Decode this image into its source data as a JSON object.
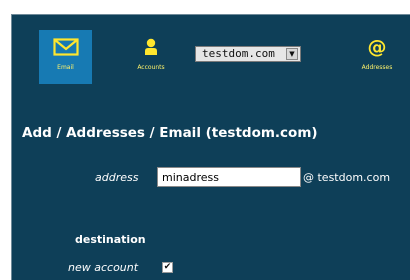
{
  "nav": {
    "items": [
      {
        "label": "Email",
        "icon": "envelope-icon",
        "active": true
      },
      {
        "label": "Accounts",
        "icon": "person-icon",
        "active": false
      },
      {
        "label": "Addresses",
        "icon": "at-sign-icon",
        "active": false
      }
    ],
    "at_glyph": "@",
    "domain_select": {
      "value": "testdom.com",
      "arrow": "▼"
    }
  },
  "page": {
    "title": "Add / Addresses / Email (testdom.com)"
  },
  "form": {
    "address_label": "address",
    "address_value": "minadress",
    "address_suffix": "@ testdom.com",
    "destination_heading": "destination",
    "new_account_label": "new account",
    "new_account_checked": true,
    "check_mark": "✔"
  },
  "colors": {
    "background": "#0e3f58",
    "active_tab": "#177ab3",
    "nav_label": "#fff36b",
    "icon": "#ffe62e"
  }
}
